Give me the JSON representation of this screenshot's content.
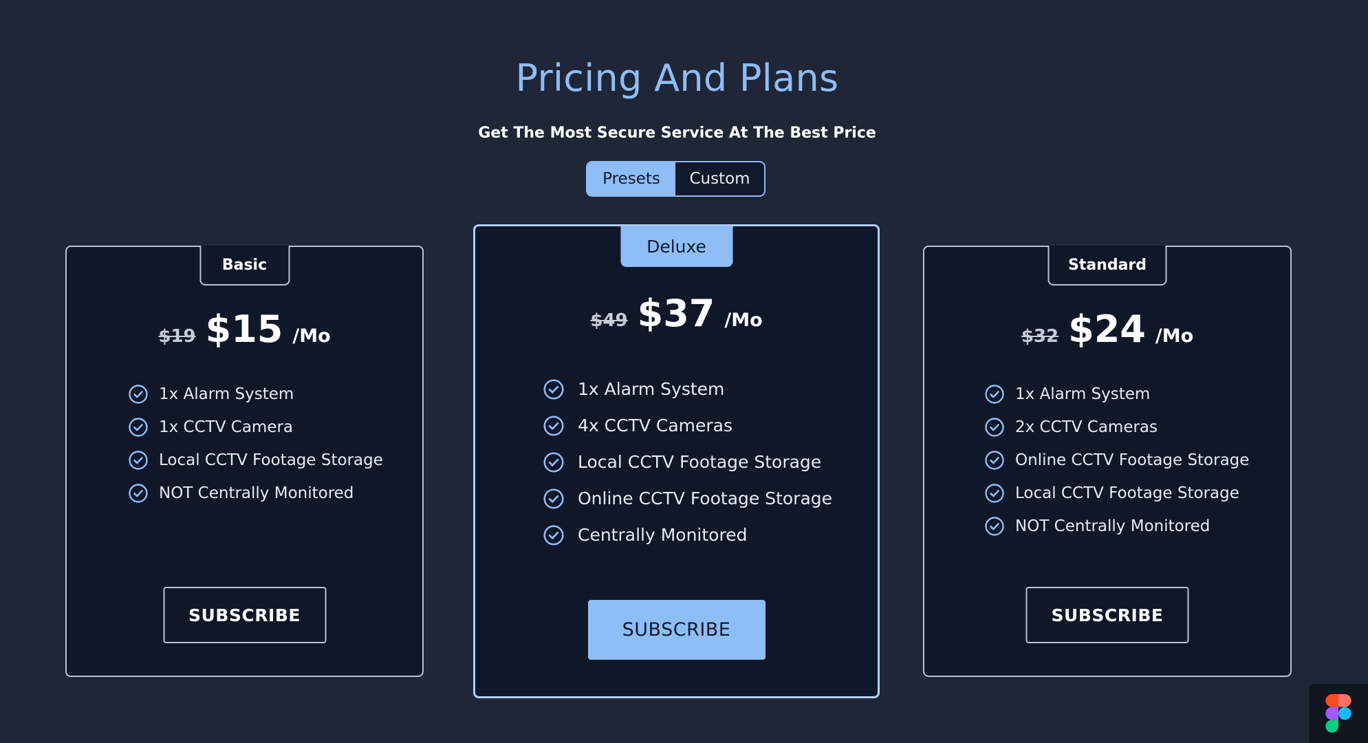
{
  "header": {
    "title": "Pricing And Plans",
    "subtitle": "Get The Most Secure Service At The Best Price"
  },
  "toggle": {
    "options": [
      "Presets",
      "Custom"
    ],
    "selected": "Presets"
  },
  "colors": {
    "background": "#1f2637",
    "card": "#0f1729",
    "accent": "#8fbdf6",
    "border": "#b9c3d3"
  },
  "plans": [
    {
      "name": "Basic",
      "old_price": "$19",
      "price": "$15",
      "period": "/Mo",
      "features": [
        "1x Alarm System",
        "1x CCTV Camera",
        "Local CCTV Footage Storage",
        "NOT Centrally Monitored"
      ],
      "cta": "SUBSCRIBE",
      "featured": false
    },
    {
      "name": "Deluxe",
      "old_price": "$49",
      "price": "$37",
      "period": "/Mo",
      "features": [
        "1x Alarm System",
        "4x CCTV Cameras",
        "Local CCTV Footage Storage",
        "Online CCTV Footage Storage",
        "Centrally Monitored"
      ],
      "cta": "SUBSCRIBE",
      "featured": true
    },
    {
      "name": "Standard",
      "old_price": "$32",
      "price": "$24",
      "period": "/Mo",
      "features": [
        "1x Alarm System",
        "2x CCTV Cameras",
        "Online CCTV Footage Storage",
        "Local CCTV Footage Storage",
        "NOT Centrally Monitored"
      ],
      "cta": "SUBSCRIBE",
      "featured": false
    }
  ],
  "icons": {
    "feature": "check-circle-icon",
    "corner": "figma-logo-icon"
  }
}
